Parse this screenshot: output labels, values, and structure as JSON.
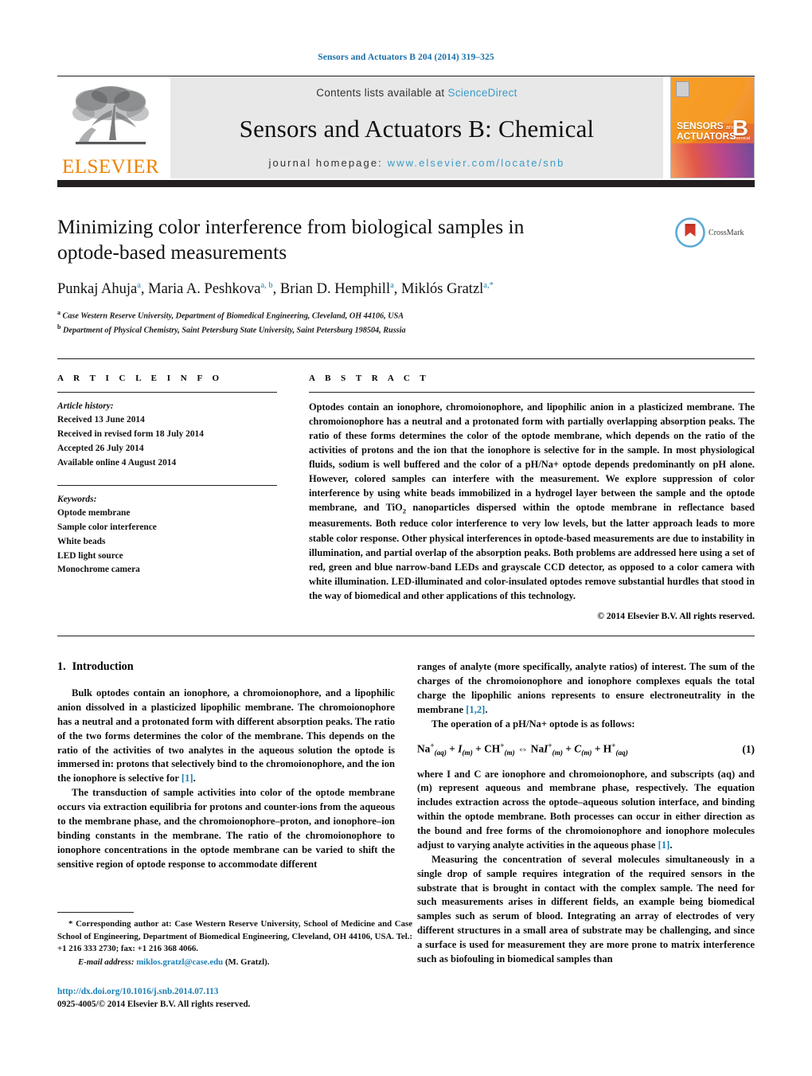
{
  "running_head": "Sensors and Actuators B 204 (2014) 319–325",
  "banner": {
    "contents_prefix": "Contents lists available at ",
    "contents_link": "ScienceDirect",
    "journal_name": "Sensors and Actuators B: Chemical",
    "homepage_prefix": "journal homepage: ",
    "homepage_link": "www.elsevier.com/locate/snb",
    "publisher": "ELSEVIER",
    "cover": {
      "title_line1": "SENSORS",
      "title_and": "and",
      "title_line2": "ACTUATORS",
      "big_letter": "B",
      "big_sub": "Chemical"
    }
  },
  "article": {
    "title": "Minimizing color interference from biological samples in optode-based measurements",
    "crossmark_label": "CrossMark",
    "authors": [
      {
        "name": "Punkaj Ahuja",
        "marks": "a"
      },
      {
        "name": "Maria A. Peshkova",
        "marks": "a, b"
      },
      {
        "name": "Brian D. Hemphill",
        "marks": "a"
      },
      {
        "name": "Miklós Gratzl",
        "marks": "a,*"
      }
    ],
    "affiliations": [
      {
        "mark": "a",
        "text": "Case Western Reserve University, Department of Biomedical Engineering, Cleveland, OH 44106, USA"
      },
      {
        "mark": "b",
        "text": "Department of Physical Chemistry, Saint Petersburg State University, Saint Petersburg 198504, Russia"
      }
    ]
  },
  "info": {
    "heading": "A R T I C L E   I N F O",
    "history_label": "Article history:",
    "history": [
      "Received 13 June 2014",
      "Received in revised form 18 July 2014",
      "Accepted 26 July 2014",
      "Available online 4 August 2014"
    ],
    "keywords_label": "Keywords:",
    "keywords": [
      "Optode membrane",
      "Sample color interference",
      "White beads",
      "LED light source",
      "Monochrome camera"
    ]
  },
  "abstract": {
    "heading": "A B S T R A C T",
    "part1": "Optodes contain an ionophore, chromoionophore, and lipophilic anion in a plasticized membrane. The chromoionophore has a neutral and a protonated form with partially overlapping absorption peaks. The ratio of these forms determines the color of the optode membrane, which depends on the ratio of the activities of protons and the ion that the ionophore is selective for in the sample. In most physiological fluids, sodium is well buffered and the color of a pH/Na+ optode depends predominantly on pH alone. However, colored samples can interfere with the measurement. We explore suppression of color interference by using white beads immobilized in a hydrogel layer between the sample and the optode membrane, and TiO",
    "sub1": "2",
    "part2": " nanoparticles dispersed within the optode membrane in reflectance based measurements. Both reduce color interference to very low levels, but the latter approach leads to more stable color response. Other physical interferences in optode-based measurements are due to instability in illumination, and partial overlap of the absorption peaks. Both problems are addressed here using a set of red, green and blue narrow-band LEDs and grayscale CCD detector, as opposed to a color camera with white illumination. LED-illuminated and color-insulated optodes remove substantial hurdles that stood in the way of biomedical and other applications of this technology.",
    "copyright": "© 2014 Elsevier B.V. All rights reserved."
  },
  "body": {
    "section_number": "1.",
    "section_title": "Introduction",
    "left_p1_a": "Bulk optodes contain an ionophore, a chromoionophore, and a lipophilic anion dissolved in a plasticized lipophilic membrane. The chromoionophore has a neutral and a protonated form with different absorption peaks. The ratio of the two forms determines the color of the membrane. This depends on the ratio of the activities of two analytes in the aqueous solution the optode is immersed in: protons that selectively bind to the chromoionophore, and the ion the ionophore is selective for ",
    "left_p1_ref": "[1]",
    "left_p1_b": ".",
    "left_p2": "The transduction of sample activities into color of the optode membrane occurs via extraction equilibria for protons and counter-ions from the aqueous to the membrane phase, and the chromoionophore–proton, and ionophore–ion binding constants in the membrane. The ratio of the chromoionophore to ionophore concentrations in the optode membrane can be varied to shift the sensitive region of optode response to accommodate different",
    "right_p1_a": "ranges of analyte (more specifically, analyte ratios) of interest. The sum of the charges of the chromoionophore and ionophore complexes equals the total charge the lipophilic anions represents to ensure electroneutrality in the membrane ",
    "right_p1_ref": "[1,2]",
    "right_p1_b": ".",
    "right_p2": "The operation of a pH/Na+ optode is as follows:",
    "equation_number": "(1)",
    "equation_text": "Na+(aq) + I(m) + CH+(m) ⇔ NaI+(m) + C(m) + H+(aq)",
    "right_p3_a": "where I and C are ionophore and chromoionophore, and subscripts (aq) and (m) represent aqueous and membrane phase, respectively. The equation includes extraction across the optode–aqueous solution interface, and binding within the optode membrane. Both processes can occur in either direction as the bound and free forms of the chromoionophore and ionophore molecules adjust to varying analyte activities in the aqueous phase ",
    "right_p3_ref": "[1]",
    "right_p3_b": ".",
    "right_p4": "Measuring the concentration of several molecules simultaneously in a single drop of sample requires integration of the required sensors in the substrate that is brought in contact with the complex sample. The need for such measurements arises in different fields, an example being biomedical samples such as serum of blood. Integrating an array of electrodes of very different structures in a small area of substrate may be challenging, and since a surface is used for measurement they are more prone to matrix interference such as biofouling in biomedical samples than"
  },
  "footnote": {
    "corresponding": "* Corresponding author at: Case Western Reserve University, School of Medicine and Case School of Engineering, Department of Biomedical Engineering, Cleveland, OH 44106, USA. Tel.: +1 216 333 2730; fax: +1 216 368 4066.",
    "email_label": "E-mail address:",
    "email": "miklos.gratzl@case.edu",
    "email_suffix": "(M. Gratzl).",
    "doi": "http://dx.doi.org/10.1016/j.snb.2014.07.113",
    "issn_line": "0925-4005/© 2014 Elsevier B.V. All rights reserved."
  },
  "colors": {
    "link_blue": "#1a7fb5",
    "banner_link": "#3a9cc9",
    "elsevier_orange": "#ef8200",
    "bar_dark": "#231f20",
    "banner_bg": "#e8e8e8"
  }
}
